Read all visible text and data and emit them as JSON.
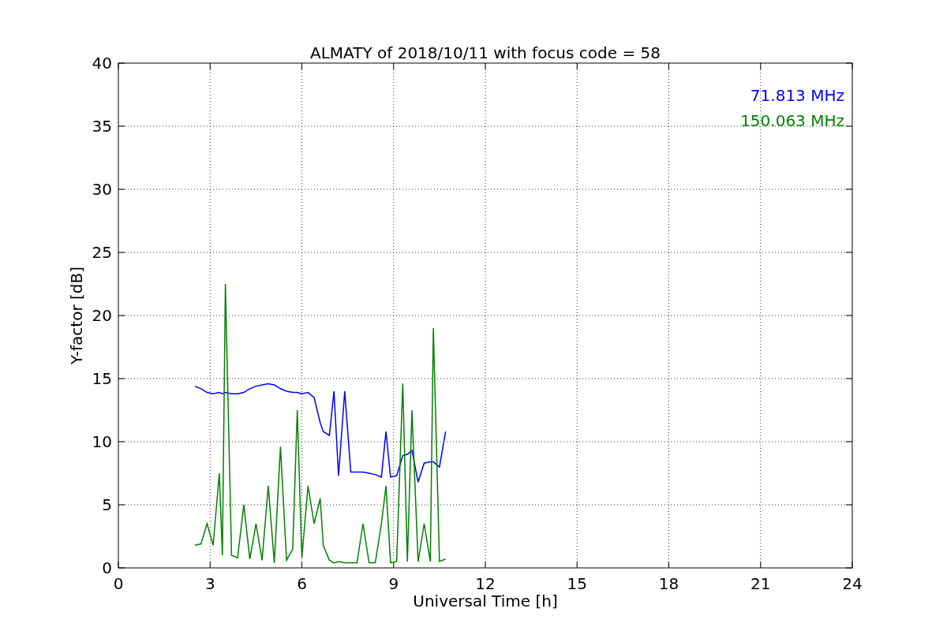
{
  "chart_data": {
    "type": "line",
    "title": "ALMATY of 2018/10/11 with focus code = 58",
    "xlabel": "Universal Time [h]",
    "ylabel": "Y-factor [dB]",
    "x": [
      2.5,
      2.7,
      2.9,
      3.1,
      3.3,
      3.4,
      3.5,
      3.7,
      3.9,
      4.1,
      4.3,
      4.5,
      4.7,
      4.9,
      5.1,
      5.3,
      5.5,
      5.7,
      5.85,
      6.0,
      6.2,
      6.4,
      6.6,
      6.7,
      6.9,
      7.05,
      7.2,
      7.4,
      7.6,
      7.8,
      8.0,
      8.2,
      8.4,
      8.6,
      8.75,
      8.9,
      9.1,
      9.3,
      9.45,
      9.6,
      9.8,
      10.0,
      10.2,
      10.3,
      10.5,
      10.7
    ],
    "series": [
      {
        "name": "71.813 MHz",
        "color": "#0000ff",
        "values": [
          14.4,
          14.2,
          13.9,
          13.8,
          13.9,
          13.8,
          13.9,
          13.8,
          13.8,
          13.9,
          14.2,
          14.4,
          14.5,
          14.6,
          14.5,
          14.2,
          14.0,
          13.9,
          13.9,
          13.8,
          13.9,
          13.5,
          11.5,
          10.8,
          10.5,
          14.0,
          7.3,
          14.0,
          7.6,
          7.6,
          7.6,
          7.5,
          7.4,
          7.2,
          10.8,
          7.2,
          7.3,
          8.9,
          9.0,
          9.3,
          6.8,
          8.3,
          8.4,
          8.4,
          8.0,
          10.8
        ]
      },
      {
        "name": "150.063 MHz",
        "color": "#008000",
        "values": [
          1.8,
          1.9,
          3.5,
          1.8,
          7.5,
          1.0,
          22.5,
          1.0,
          0.8,
          5.0,
          0.7,
          3.5,
          0.6,
          6.5,
          0.4,
          9.6,
          0.6,
          1.5,
          12.5,
          0.8,
          6.5,
          3.5,
          5.5,
          1.8,
          0.6,
          0.4,
          0.5,
          0.4,
          0.4,
          0.4,
          3.5,
          0.4,
          0.4,
          3.5,
          6.5,
          0.4,
          0.5,
          14.6,
          0.5,
          12.5,
          0.5,
          3.5,
          0.5,
          19.0,
          0.5,
          0.7
        ]
      }
    ],
    "grid": true,
    "xlim": [
      0,
      24
    ],
    "ylim": [
      0,
      40
    ],
    "xticks": [
      0,
      3,
      6,
      9,
      12,
      15,
      18,
      21,
      24
    ],
    "yticks": [
      0,
      5,
      10,
      15,
      20,
      25,
      30,
      35,
      40
    ]
  }
}
